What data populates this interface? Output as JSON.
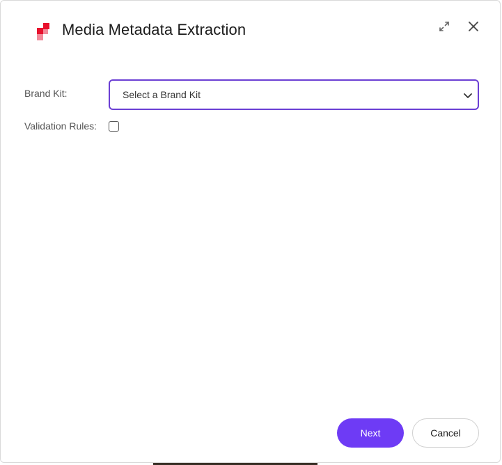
{
  "dialog": {
    "title": "Media Metadata Extraction",
    "logo_icon": "brand-logo-icon",
    "expand_icon": "expand-icon",
    "close_icon": "close-icon"
  },
  "form": {
    "brand_kit_label": "Brand Kit:",
    "brand_kit_placeholder": "Select a Brand Kit",
    "validation_rules_label": "Validation Rules:",
    "validation_rules_checked": false
  },
  "footer": {
    "next_label": "Next",
    "cancel_label": "Cancel"
  },
  "colors": {
    "accent": "#6e3bf5",
    "select_border": "#6b3fd4",
    "logo_red": "#e8112d",
    "logo_pink": "#f28a9a"
  }
}
